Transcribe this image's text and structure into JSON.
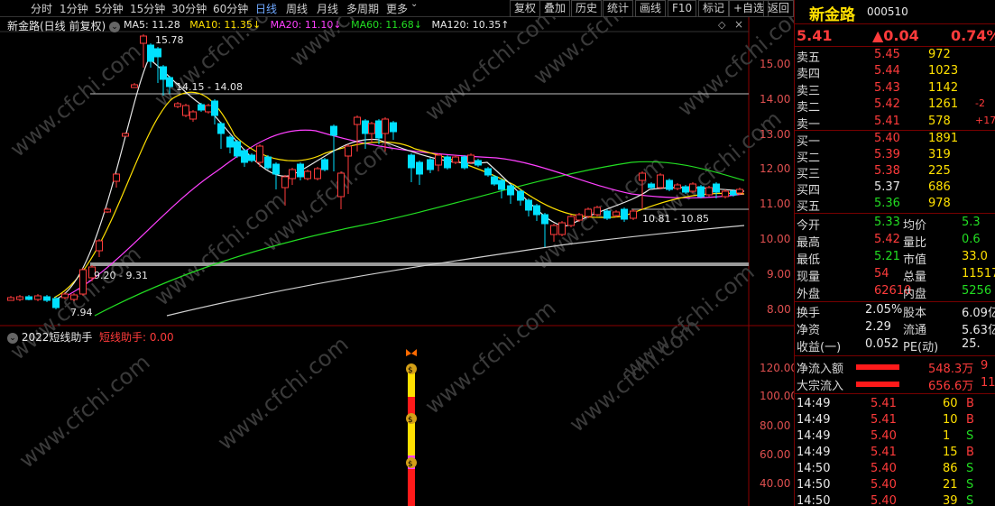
{
  "toolbar": {
    "periods": [
      "分时",
      "1分钟",
      "5分钟",
      "15分钟",
      "30分钟",
      "60分钟",
      "日线",
      "周线",
      "月线",
      "多周期",
      "更多"
    ],
    "active_period": "日线",
    "tools": [
      "复权",
      "叠加",
      "历史",
      "统计",
      "画线",
      "F10",
      "标记",
      "+自选",
      "返回"
    ]
  },
  "chart": {
    "title": "新金路(日线 前复权)",
    "ma_labels": [
      {
        "text": "MA5: 11.28",
        "color": "#e8e8e8"
      },
      {
        "text": "MA10: 11.35↓",
        "color": "#ffe000"
      },
      {
        "text": "MA20: 11.10↓",
        "color": "#ff40ff"
      },
      {
        "text": "MA60: 11.68↓",
        "color": "#22dd22"
      },
      {
        "text": "MA120: 10.35↑",
        "color": "#e8e8e8"
      }
    ],
    "y_ticks": [
      "15.00",
      "14.00",
      "13.00",
      "12.00",
      "11.00",
      "10.00",
      "9.00",
      "8.00"
    ],
    "annotations": {
      "high": "15.78",
      "low": "7.94",
      "line1": "14.15 - 14.08",
      "line2": "9.20 - 9.31",
      "line3": "10.81 - 10.85"
    },
    "watermark": "www.cfchi.com"
  },
  "indicator": {
    "title": "2022短线助手",
    "subtitle": "短线助手: 0.00",
    "y_ticks": [
      "120.00",
      "100.00",
      "80.00",
      "60.00",
      "40.00"
    ]
  },
  "quote": {
    "name": "新金路",
    "code": "000510",
    "price": "5.41",
    "change": "▲0.04",
    "change_pct": "0.74%",
    "asks": [
      {
        "label": "卖五",
        "price": "5.45",
        "vol": "972",
        "extra": ""
      },
      {
        "label": "卖四",
        "price": "5.44",
        "vol": "1023",
        "extra": ""
      },
      {
        "label": "卖三",
        "price": "5.43",
        "vol": "1142",
        "extra": ""
      },
      {
        "label": "卖二",
        "price": "5.42",
        "vol": "1261",
        "extra": "-2"
      },
      {
        "label": "卖一",
        "price": "5.41",
        "vol": "578",
        "extra": "+17"
      }
    ],
    "bids": [
      {
        "label": "买一",
        "price": "5.40",
        "vol": "1891",
        "color": "red"
      },
      {
        "label": "买二",
        "price": "5.39",
        "vol": "319",
        "color": "red"
      },
      {
        "label": "买三",
        "price": "5.38",
        "vol": "225",
        "color": "red"
      },
      {
        "label": "买四",
        "price": "5.37",
        "vol": "686",
        "color": "white"
      },
      {
        "label": "买五",
        "price": "5.36",
        "vol": "978",
        "color": "green"
      }
    ],
    "stats": [
      {
        "l1": "今开",
        "v1": "5.33",
        "c1": "green",
        "l2": "均价",
        "v2": "5.3"
      },
      {
        "l1": "最高",
        "v1": "5.42",
        "c1": "red",
        "l2": "量比",
        "v2": "0.6"
      },
      {
        "l1": "最低",
        "v1": "5.21",
        "c1": "green",
        "l2": "市值",
        "v2": "33.0"
      },
      {
        "l1": "现量",
        "v1": "54",
        "c1": "red",
        "l2": "总量",
        "v2": "11517"
      },
      {
        "l1": "外盘",
        "v1": "62610",
        "c1": "red",
        "l2": "内盘",
        "v2": "5256"
      }
    ],
    "fund": [
      {
        "l1": "换手",
        "v1": "2.05%",
        "l2": "股本",
        "v2": "6.09亿"
      },
      {
        "l1": "净资",
        "v1": "2.29",
        "l2": "流通",
        "v2": "5.63亿"
      },
      {
        "l1": "收益(一)",
        "v1": "0.052",
        "l2": "PE(动)",
        "v2": "25."
      }
    ],
    "flows": [
      {
        "label": "净流入额",
        "value": "548.3万",
        "extra": "9"
      },
      {
        "label": "大宗流入",
        "value": "656.6万",
        "extra": "11"
      }
    ],
    "ticks": [
      {
        "time": "14:49",
        "price": "5.41",
        "vol": "60",
        "side": "B"
      },
      {
        "time": "14:49",
        "price": "5.41",
        "vol": "10",
        "side": "B"
      },
      {
        "time": "14:49",
        "price": "5.40",
        "vol": "1",
        "side": "S"
      },
      {
        "time": "14:49",
        "price": "5.41",
        "vol": "15",
        "side": "B"
      },
      {
        "time": "14:50",
        "price": "5.40",
        "vol": "86",
        "side": "S"
      },
      {
        "time": "14:50",
        "price": "5.40",
        "vol": "21",
        "side": "S"
      },
      {
        "time": "14:50",
        "price": "5.40",
        "vol": "39",
        "side": "S"
      }
    ]
  }
}
